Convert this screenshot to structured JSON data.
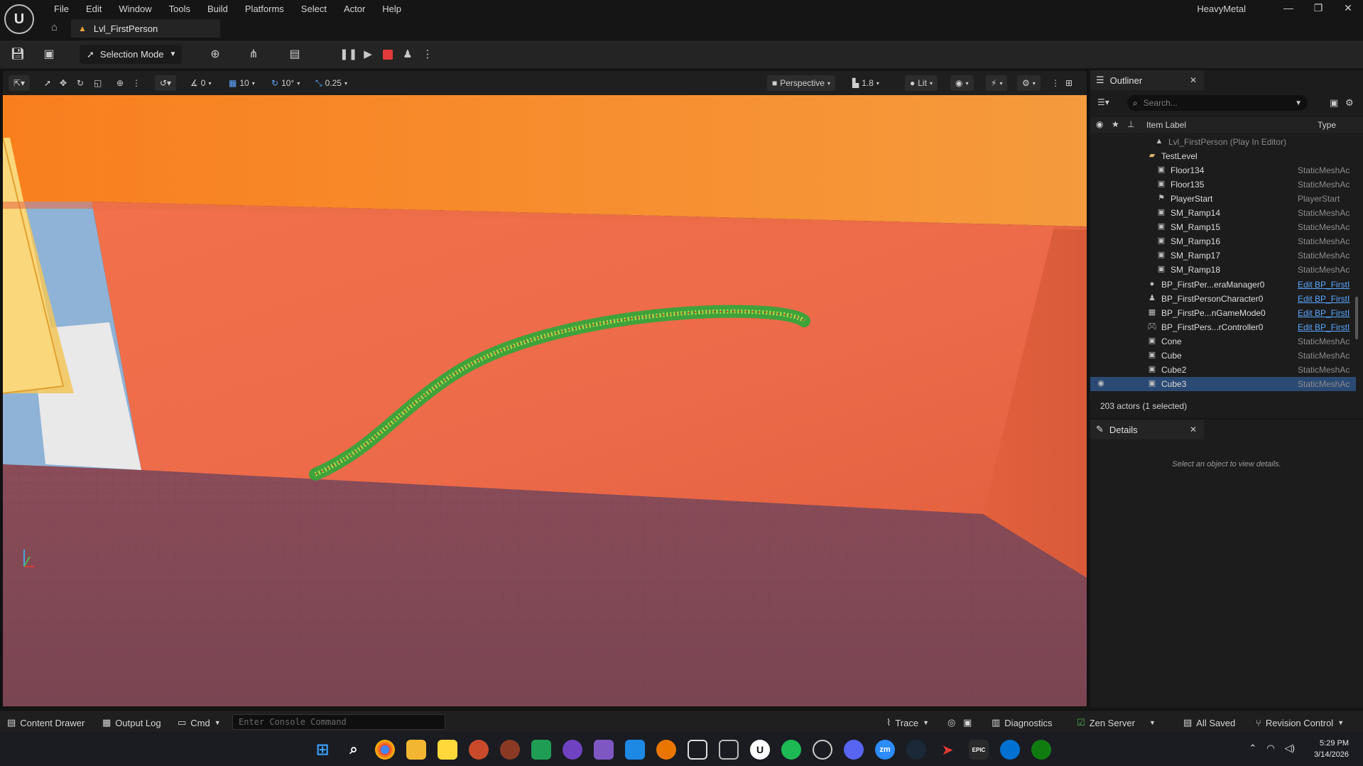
{
  "app": {
    "project_name": "HeavyMetal",
    "menu": [
      "File",
      "Edit",
      "Window",
      "Tools",
      "Build",
      "Platforms",
      "Select",
      "Actor",
      "Help"
    ],
    "level_tab": "Lvl_FirstPerson",
    "window_controls": [
      "—",
      "❐",
      "✕"
    ]
  },
  "toolbar": {
    "selection_mode": "Selection Mode"
  },
  "viewport_toolbar": {
    "rotation_snap_value": "0",
    "grid_snap": "10",
    "rotation_snap": "10°",
    "scale_snap": "0.25",
    "view_mode": "Perspective",
    "camera_speed": "1.8",
    "lighting": "Lit"
  },
  "outliner": {
    "title": "Outliner",
    "search_placeholder": "Search...",
    "col_label": "Item Label",
    "col_type": "Type",
    "rows": [
      {
        "name": "Lvl_FirstPerson (Play In Editor)",
        "type": ""
      },
      {
        "name": "TestLevel",
        "type": ""
      },
      {
        "name": "Floor134",
        "type": "StaticMeshAc"
      },
      {
        "name": "Floor135",
        "type": "StaticMeshAc"
      },
      {
        "name": "PlayerStart",
        "type": "PlayerStart"
      },
      {
        "name": "SM_Ramp14",
        "type": "StaticMeshAc"
      },
      {
        "name": "SM_Ramp15",
        "type": "StaticMeshAc"
      },
      {
        "name": "SM_Ramp16",
        "type": "StaticMeshAc"
      },
      {
        "name": "SM_Ramp17",
        "type": "StaticMeshAc"
      },
      {
        "name": "SM_Ramp18",
        "type": "StaticMeshAc"
      },
      {
        "name": "BP_FirstPer...eraManager0",
        "type": "Edit BP_FirstI"
      },
      {
        "name": "BP_FirstPersonCharacter0",
        "type": "Edit BP_FirstI"
      },
      {
        "name": "BP_FirstPe...nGameMode0",
        "type": "Edit BP_FirstI"
      },
      {
        "name": "BP_FirstPers...rController0",
        "type": "Edit BP_FirstI"
      },
      {
        "name": "Cone",
        "type": "StaticMeshAc"
      },
      {
        "name": "Cube",
        "type": "StaticMeshAc"
      },
      {
        "name": "Cube2",
        "type": "StaticMeshAc"
      },
      {
        "name": "Cube3",
        "type": "StaticMeshAc"
      }
    ],
    "actor_count": "203 actors (1 selected)"
  },
  "details": {
    "title": "Details",
    "empty_text": "Select an object to view details."
  },
  "statusbar": {
    "content_drawer": "Content Drawer",
    "output_log": "Output Log",
    "cmd": "Cmd",
    "console_placeholder": "Enter Console Command",
    "trace": "Trace",
    "diagnostics": "Diagnostics",
    "zen_server": "Zen Server",
    "all_saved": "All Saved",
    "revision_control": "Revision Control"
  },
  "taskbar": {
    "time": "5:29 PM",
    "date": "3/14/2026",
    "app_labels": {
      "zoom": "zm",
      "epic": "EPIC"
    }
  },
  "colors": {
    "selected_row": "#2a4a74",
    "link": "#5aa7ff",
    "stop": "#e23a3a"
  }
}
